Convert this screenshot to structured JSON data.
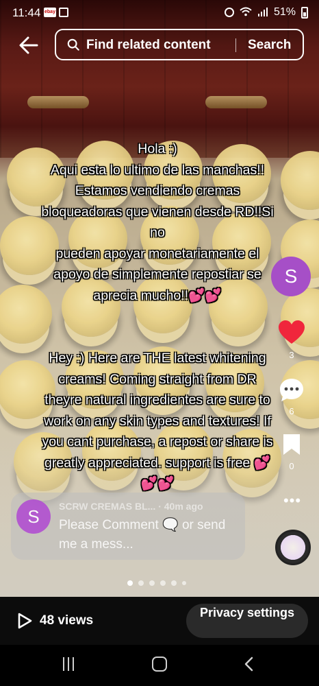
{
  "status_bar": {
    "time": "11:44",
    "battery": "51%",
    "notification_icons": [
      "ebay-icon",
      "image-icon"
    ],
    "system_icons": [
      "alarm-icon",
      "wifi-icon",
      "signal-icon",
      "battery-icon"
    ]
  },
  "search": {
    "placeholder": "Find related content",
    "button_label": "Search"
  },
  "caption": {
    "paragraph_1": "Hola :)\nAqui esta lo ultimo de las manchas!!\nEstamos vendiendo cremas\nbloqueadoras que vienen desde RD!!Si\nno\npueden apoyar monetariamente el\napoyo de simplemente repostiar se\naprecia mucho!!💕💕",
    "paragraph_2": "Hey :) Here are THE latest whitening\ncreams! Coming straight from DR\ntheyre natural ingredientes are sure to\nwork on any skin types and textures! If\nyou cant purchase, a repost or share is\ngreatly appreciated. support is free 💕\n💕💕"
  },
  "rail": {
    "avatar_letter": "S",
    "likes": "3",
    "comments": "6",
    "saves": "0",
    "like_color": "#f0263c",
    "avatar_color": "#a64fc7"
  },
  "comment_preview": {
    "avatar_letter": "S",
    "author": "SCRW CREMAS BL...",
    "time": "· 40m ago",
    "text": "Please Comment 🗨️ or send me a mess..."
  },
  "carousel": {
    "total_dots": 6,
    "active_index": 0
  },
  "bottom": {
    "views": "48 views",
    "privacy_button": "Privacy settings"
  }
}
